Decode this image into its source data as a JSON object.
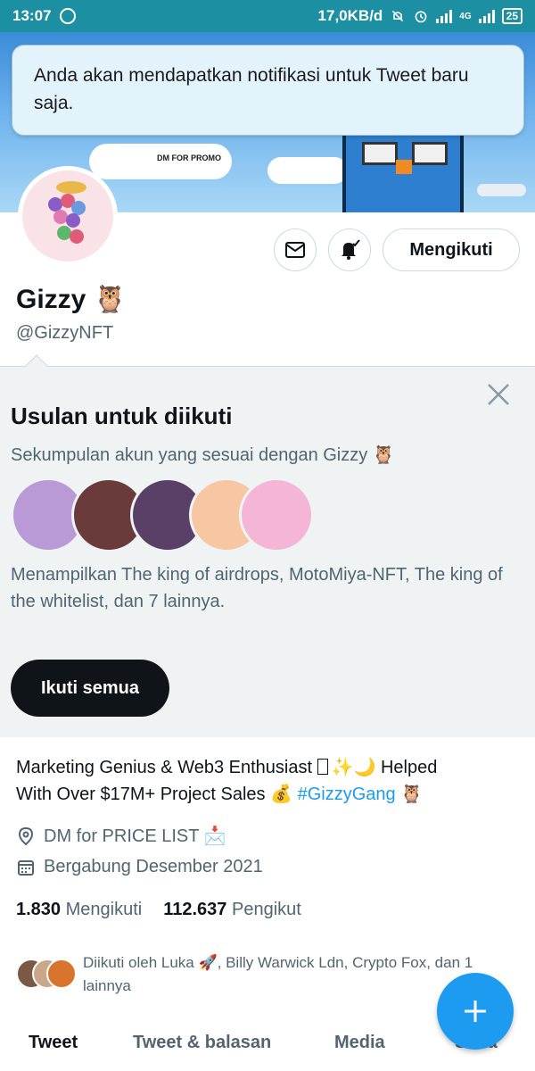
{
  "status_bar": {
    "time": "13:07",
    "speed": "17,0KB/d",
    "network": "4G",
    "battery": "25",
    "icons": [
      "whatsapp-icon",
      "mute-icon",
      "alarm-icon",
      "signal-icon",
      "battery-icon"
    ]
  },
  "toast": {
    "message": "Anda akan mendapatkan notifikasi untuk Tweet baru saja."
  },
  "banner": {
    "promo_text": "DM FOR PROMO"
  },
  "profile": {
    "name": "Gizzy",
    "name_emoji": "🦉",
    "handle": "@GizzyNFT",
    "follow_button": "Mengikuti",
    "bio_line1": "Marketing Genius & Web3 Enthusiast ",
    "bio_line1_emojis": "✨🌙 Helped",
    "bio_line2": "With Over $17M+ Project Sales 💰 ",
    "bio_hashtag": "#GizzyGang",
    "bio_end_emoji": " 🦉",
    "location": "DM for PRICE LIST 📩",
    "joined": "Bergabung Desember 2021",
    "following_count": "1.830",
    "following_label": "Mengikuti",
    "followers_count": "112.637",
    "followers_label": "Pengikut",
    "followed_by": "Diikuti oleh Luka 🚀, Billy Warwick Ldn, Crypto Fox, dan 1 lainnya"
  },
  "suggestions": {
    "title": "Usulan untuk diikuti",
    "subtitle": "Sekumpulan akun yang sesuai dengan Gizzy 🦉",
    "description": "Menampilkan The king of airdrops, MotoMiya-NFT, The king of the whitelist, dan 7 lainnya.",
    "follow_all": "Ikuti semua",
    "face_colors": [
      "#b99ad6",
      "#6b3b3b",
      "#5a3f66",
      "#f6c7a2",
      "#f5b6d6"
    ]
  },
  "tabs": [
    "Tweet",
    "Tweet & balasan",
    "Media",
    "Suka"
  ],
  "colors": {
    "accent": "#1d9bf0",
    "status_bar": "#1d8fa3",
    "text_primary": "#0f1419",
    "text_secondary": "#536471"
  }
}
